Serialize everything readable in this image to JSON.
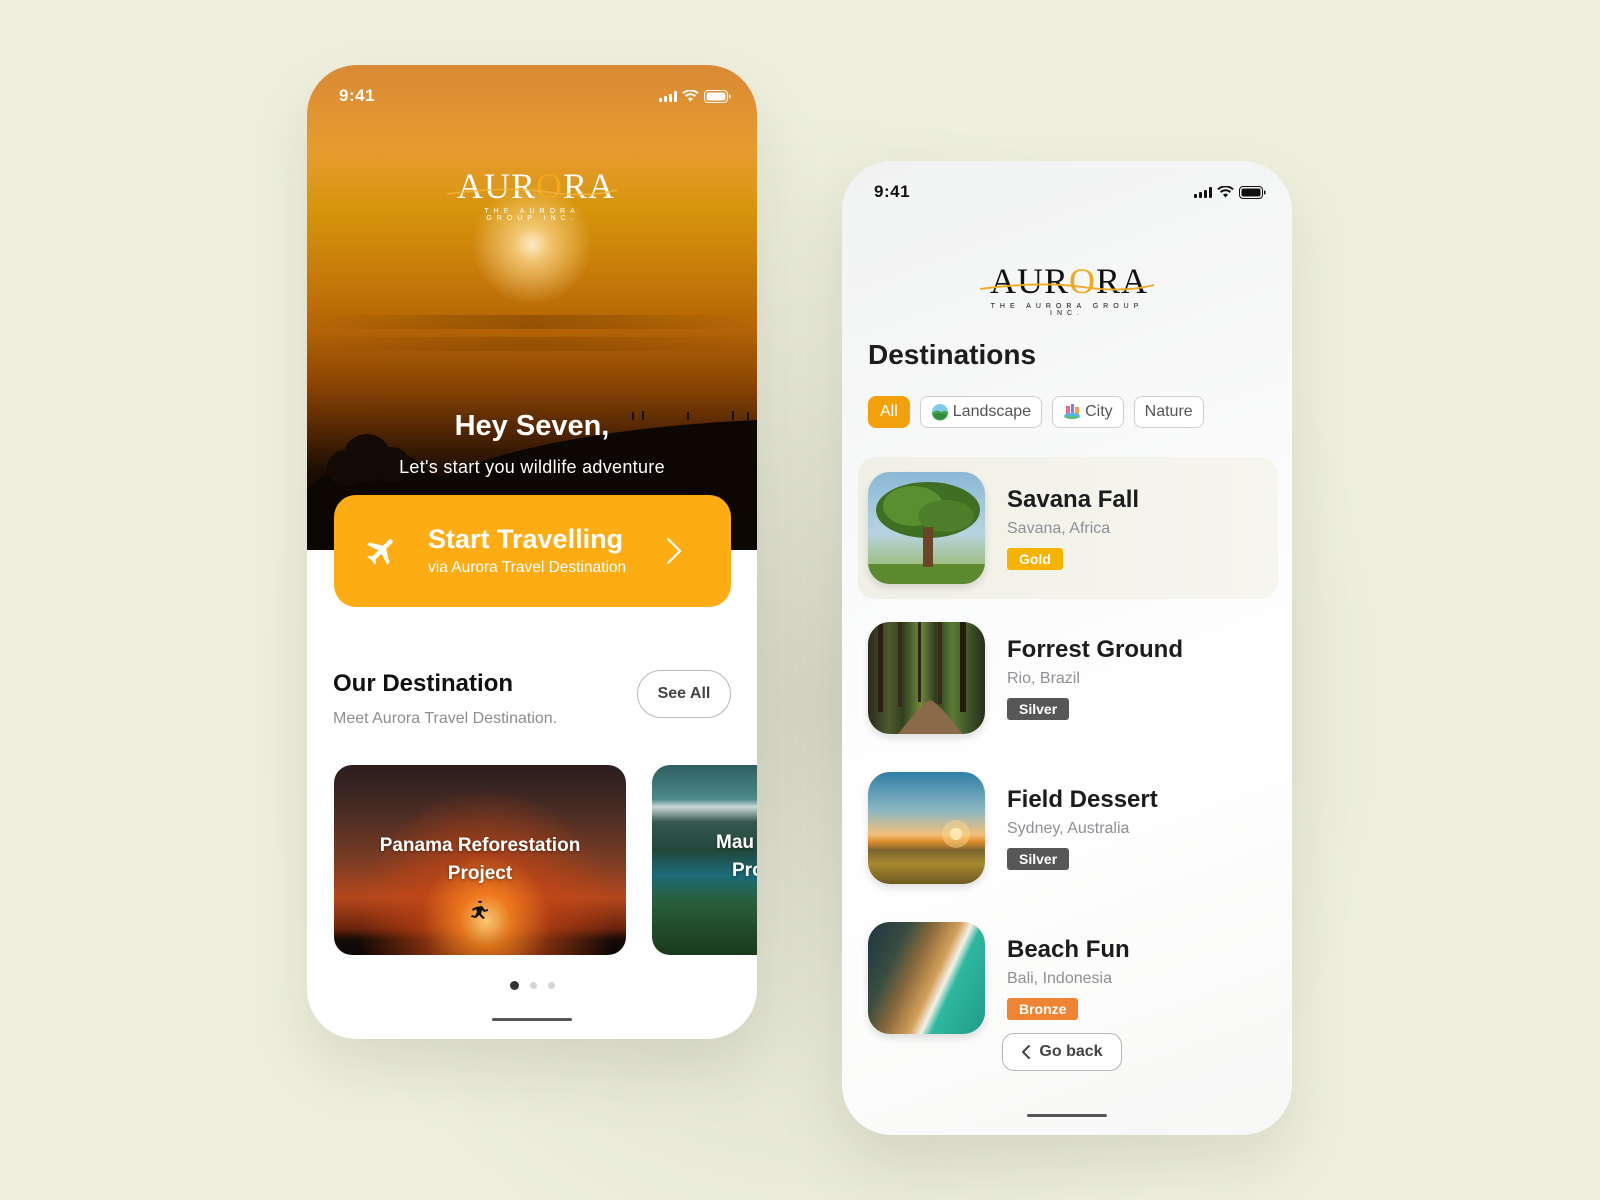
{
  "colors": {
    "background": "#eeefdd",
    "accent": "#fdac14",
    "chip_active": "#f2a10d",
    "badge_gold": "#f6b300",
    "badge_silver": "#575757",
    "badge_bronze": "#ef8534"
  },
  "phone1": {
    "status": {
      "time": "9:41",
      "icons": [
        "signal-icon",
        "wifi-icon",
        "battery-icon"
      ]
    },
    "logo": {
      "word_before": "AUR",
      "word_o": "O",
      "word_after": "RA",
      "tagline": "THE AURORA GROUP INC."
    },
    "hero": {
      "title": "Hey Seven,",
      "subtitle": "Let's start you wildlife adventure"
    },
    "cta": {
      "icon": "airplane-icon",
      "title": "Start Travelling",
      "subtitle": "via Aurora Travel Destination",
      "chevron": "chevron-right-icon"
    },
    "section": {
      "title": "Our Destination",
      "subtitle": "Meet Aurora Travel Destination.",
      "see_all": "See All"
    },
    "cards": [
      {
        "line1": "Panama Reforestation",
        "line2": "Project"
      },
      {
        "line1": "Mau",
        "line2": "Pro"
      }
    ],
    "pagination": {
      "total": 3,
      "active": 1
    }
  },
  "phone2": {
    "status": {
      "time": "9:41",
      "icons": [
        "signal-icon",
        "wifi-icon",
        "battery-icon"
      ]
    },
    "logo": {
      "word_before": "AUR",
      "word_o": "O",
      "word_after": "RA",
      "tagline": "THE AURORA GROUP INC."
    },
    "title": "Destinations",
    "filters": [
      {
        "label": "All",
        "icon": "",
        "active": true
      },
      {
        "label": "Landscape",
        "icon": "landscape-icon",
        "active": false
      },
      {
        "label": "City",
        "icon": "city-icon",
        "active": false
      },
      {
        "label": "Nature",
        "icon": "",
        "active": false
      }
    ],
    "destinations": [
      {
        "name": "Savana Fall",
        "location": "Savana, Africa",
        "tier": "Gold",
        "selected": true
      },
      {
        "name": "Forrest Ground",
        "location": "Rio, Brazil",
        "tier": "Silver",
        "selected": false
      },
      {
        "name": "Field Dessert",
        "location": "Sydney, Australia",
        "tier": "Silver",
        "selected": false
      },
      {
        "name": "Beach Fun",
        "location": "Bali, Indonesia",
        "tier": "Bronze",
        "selected": false
      }
    ],
    "go_back": "Go back"
  }
}
